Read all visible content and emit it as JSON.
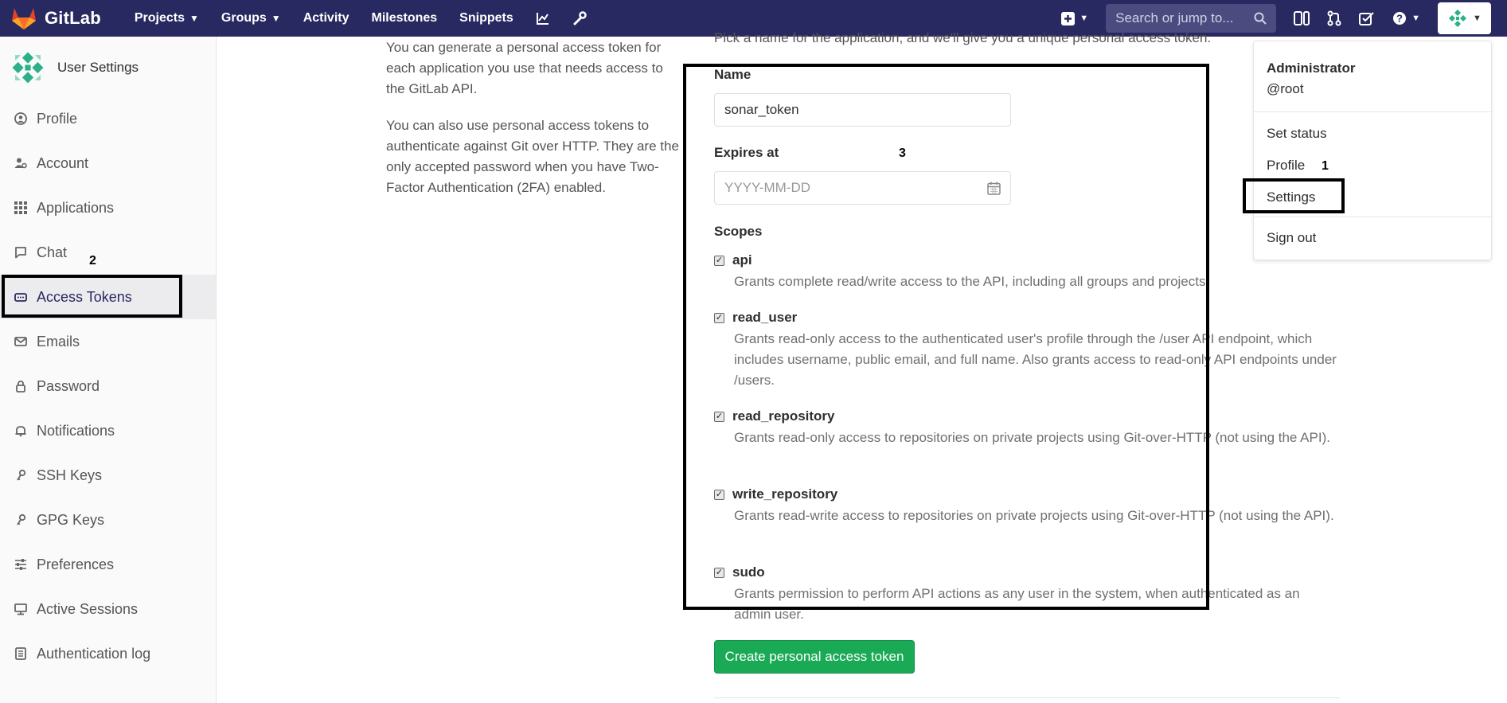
{
  "navbar": {
    "brand": "GitLab",
    "links": [
      {
        "label": "Projects",
        "caret": true
      },
      {
        "label": "Groups",
        "caret": true
      },
      {
        "label": "Activity"
      },
      {
        "label": "Milestones"
      },
      {
        "label": "Snippets"
      }
    ],
    "search_placeholder": "Search or jump to..."
  },
  "sidebar": {
    "title": "User Settings",
    "items": [
      {
        "label": "Profile",
        "icon": "profile-icon"
      },
      {
        "label": "Account",
        "icon": "account-icon"
      },
      {
        "label": "Applications",
        "icon": "applications-icon"
      },
      {
        "label": "Chat",
        "icon": "chat-icon"
      },
      {
        "label": "Access Tokens",
        "icon": "access-tokens-icon",
        "active": true
      },
      {
        "label": "Emails",
        "icon": "email-icon"
      },
      {
        "label": "Password",
        "icon": "lock-icon"
      },
      {
        "label": "Notifications",
        "icon": "bell-icon"
      },
      {
        "label": "SSH Keys",
        "icon": "key-icon"
      },
      {
        "label": "GPG Keys",
        "icon": "key-icon"
      },
      {
        "label": "Preferences",
        "icon": "sliders-icon"
      },
      {
        "label": "Active Sessions",
        "icon": "monitor-icon"
      },
      {
        "label": "Authentication log",
        "icon": "log-icon"
      }
    ]
  },
  "intro": {
    "p1": "You can generate a personal access token for each application you use that needs access to the GitLab API.",
    "p2": "You can also use personal access tokens to authenticate against Git over HTTP. They are the only accepted password when you have Two-Factor Authentication (2FA) enabled."
  },
  "form": {
    "top_text": "Pick a name for the application, and we'll give you a unique personal access token.",
    "name_label": "Name",
    "name_value": "sonar_token",
    "expires_label": "Expires at",
    "expires_placeholder": "YYYY-MM-DD",
    "scopes_label": "Scopes",
    "scopes": [
      {
        "name": "api",
        "checked": true,
        "desc": "Grants complete read/write access to the API, including all groups and projects."
      },
      {
        "name": "read_user",
        "checked": true,
        "desc": "Grants read-only access to the authenticated user's profile through the /user API endpoint, which includes username, public email, and full name. Also grants access to read-only API endpoints under /users."
      },
      {
        "name": "read_repository",
        "checked": true,
        "desc": "Grants read-only access to repositories on private projects using Git-over-HTTP (not using the API)."
      },
      {
        "name": "write_repository",
        "checked": true,
        "desc": "Grants read-write access to repositories on private projects using Git-over-HTTP (not using the API)."
      },
      {
        "name": "sudo",
        "checked": true,
        "desc": "Grants permission to perform API actions as any user in the system, when authenticated as an admin user."
      }
    ],
    "submit_label": "Create personal access token"
  },
  "user_menu": {
    "name": "Administrator",
    "username": "@root",
    "items": [
      "Set status",
      "Profile",
      "Settings",
      "Sign out"
    ]
  },
  "annotations": [
    "1",
    "2",
    "3"
  ],
  "colors": {
    "navbar": "#292961",
    "primary_button": "#1aaa55",
    "annotation": "#000000"
  }
}
